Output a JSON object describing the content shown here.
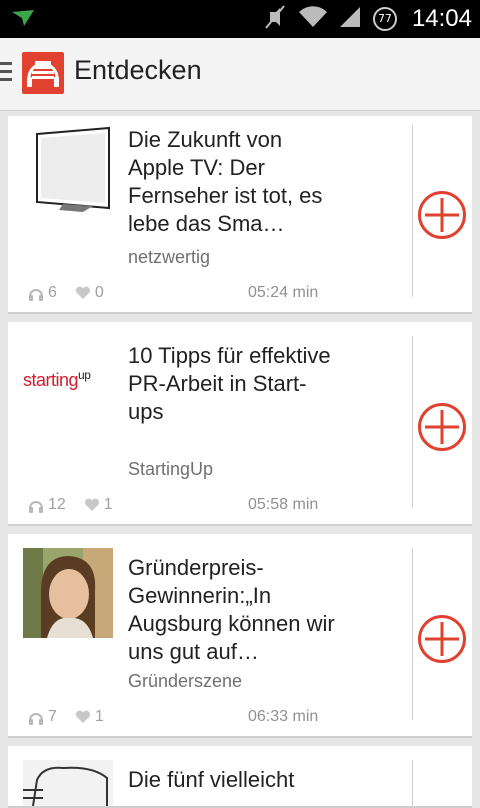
{
  "status_bar": {
    "time": "14:04",
    "battery_level": "77"
  },
  "app_bar": {
    "title": "Entdecken"
  },
  "items": [
    {
      "title": "Die Zukunft von Apple TV: Der Fernseher ist tot, es lebe das Sma…",
      "source": "netzwertig",
      "listens": "6",
      "likes": "0",
      "duration": "05:24 min",
      "thumb": "tv"
    },
    {
      "title": "10 Tipps für effektive PR-Arbeit in Start-ups",
      "source": "StartingUp",
      "listens": "12",
      "likes": "1",
      "duration": "05:58 min",
      "thumb": "startingup",
      "thumb_text_main": "starting",
      "thumb_text_sup": "up"
    },
    {
      "title": "Gründerpreis-Gewinnerin:„In Augsburg können wir uns gut auf…",
      "source": "Gründerszene",
      "listens": "7",
      "likes": "1",
      "duration": "06:33 min",
      "thumb": "portrait"
    },
    {
      "title": "Die fünf vielleicht",
      "thumb": "drawing"
    }
  ],
  "colors": {
    "accent": "#e1412f",
    "status_bar": "#000000",
    "app_bar": "#f4f4f4",
    "background": "#e6e6e6"
  }
}
